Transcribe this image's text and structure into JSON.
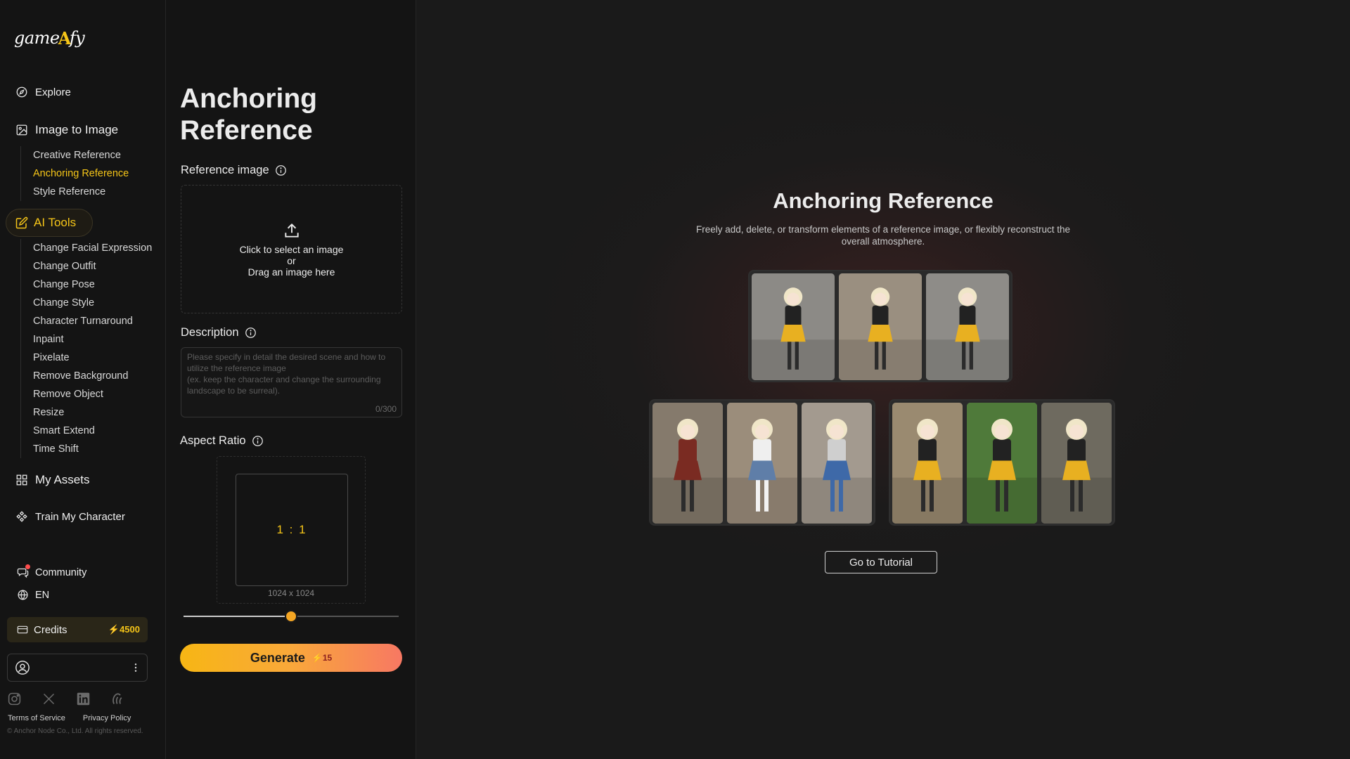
{
  "logo": {
    "text_left": "game",
    "text_mark": "A",
    "text_right": "fy"
  },
  "sidebar": {
    "explore": "Explore",
    "image_to_image": "Image to Image",
    "i2i_items": [
      {
        "label": "Creative Reference",
        "active": false
      },
      {
        "label": "Anchoring Reference",
        "active": true
      },
      {
        "label": "Style Reference",
        "active": false
      }
    ],
    "ai_tools": "AI Tools",
    "ai_items": [
      {
        "label": "Change Facial Expression"
      },
      {
        "label": "Change Outfit"
      },
      {
        "label": "Change Pose"
      },
      {
        "label": "Change Style"
      },
      {
        "label": "Character Turnaround"
      },
      {
        "label": "Inpaint"
      },
      {
        "label": "Pixelate"
      },
      {
        "label": "Remove Background"
      },
      {
        "label": "Remove Object"
      },
      {
        "label": "Resize"
      },
      {
        "label": "Smart Extend"
      },
      {
        "label": "Time Shift"
      }
    ],
    "my_assets": "My Assets",
    "train": "Train My Character",
    "community": "Community",
    "language": "EN",
    "credits_label": "Credits",
    "credits_amount": "4500",
    "footer_terms": "Terms of Service",
    "footer_privacy": "Privacy Policy",
    "copyright": "© Anchor Node Co., Ltd. All rights reserved."
  },
  "panel": {
    "title": "Anchoring Reference",
    "ref_label": "Reference image",
    "upload_line1": "Click to select an image",
    "upload_line2": "or",
    "upload_line3": "Drag an image here",
    "desc_label": "Description",
    "desc_placeholder": "Please specify in detail the desired scene and how to utilize the reference image\n(ex. keep the character and change the surrounding landscape to be surreal).",
    "desc_count": "0/300",
    "aspect_label": "Aspect Ratio",
    "aspect_value": "1 : 1",
    "aspect_size": "1024 x 1024",
    "slider_value": 0.5,
    "generate_label": "Generate",
    "generate_cost": "15"
  },
  "main": {
    "title": "Anchoring Reference",
    "subtitle": "Freely add, delete, or transform elements of a reference image, or flexibly reconstruct the overall atmosphere.",
    "tutorial_button": "Go to Tutorial",
    "top_images": [
      {
        "bg": "#8c8a86",
        "outfit": "#222222",
        "skirt": "#e8b021",
        "pose": "kneel"
      },
      {
        "bg": "#9a8f80",
        "outfit": "#222222",
        "skirt": "#e8b021",
        "pose": "jump"
      },
      {
        "bg": "#8e8c88",
        "outfit": "#222222",
        "skirt": "#e8b021",
        "pose": "sword"
      }
    ],
    "left_images": [
      {
        "bg": "#857a6c",
        "outfit": "#7a2b22",
        "skirt": "#7a2b22",
        "legs": "#2c2c2c"
      },
      {
        "bg": "#9b8d7b",
        "outfit": "#efefef",
        "skirt": "#5f7ea8",
        "legs": "#f2f2f2"
      },
      {
        "bg": "#a39a8f",
        "outfit": "#cfcfcf",
        "skirt": "#3e69a8",
        "legs": "#3e69a8"
      }
    ],
    "right_images": [
      {
        "bg": "#9a8a70",
        "outfit": "#222222",
        "skirt": "#e8b021",
        "legs": "#2b2b2b"
      },
      {
        "bg": "#4f7a3a",
        "outfit": "#222222",
        "skirt": "#e8b021",
        "legs": "#2b2b2b"
      },
      {
        "bg": "#6e6a5f",
        "outfit": "#222222",
        "skirt": "#e8b021",
        "legs": "#2b2b2b"
      }
    ]
  }
}
